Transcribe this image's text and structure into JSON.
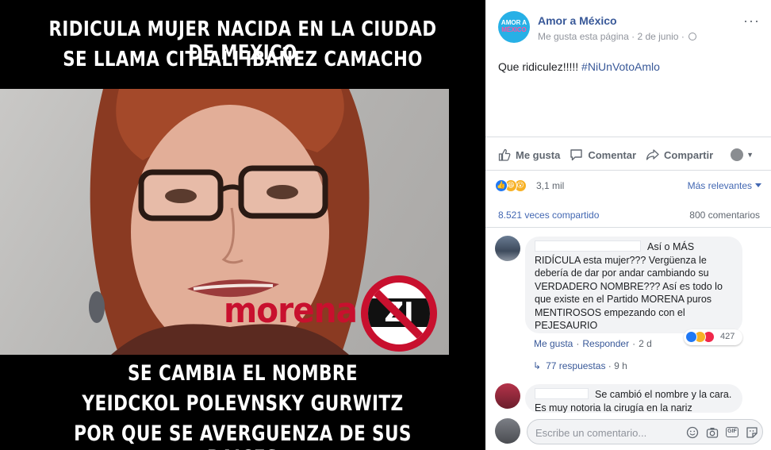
{
  "meme": {
    "caption_top": [
      "RIDICULA MUJER NACIDA EN LA CIUDAD DE MEXICO",
      "SE LLAMA CITLALI IBAÑEZ CAMACHO"
    ],
    "caption_bottom": [
      "SE CAMBIA EL NOMBRE",
      "YEIDCKOL POLEVNSKY GURWITZ",
      "POR QUE SE AVERGUENZA DE SUS RAICES"
    ],
    "logo_text": "morena",
    "logo_badge": "ZI"
  },
  "post": {
    "page_name": "Amor a México",
    "avatar_text": [
      "AMOR A",
      "MÉXICO"
    ],
    "like_page": "Me gusta esta página",
    "date": "2 de junio",
    "dot": "·",
    "text": "Que ridiculez!!!!! ",
    "hashtag": "#NiUnVotoAmlo",
    "menu": "···"
  },
  "actions": {
    "like": "Me gusta",
    "comment": "Comentar",
    "share": "Compartir"
  },
  "reactions": {
    "count": "3,1 mil",
    "sort": "Más relevantes",
    "shares": "8.521 veces compartido",
    "comments": "800 comentarios"
  },
  "comments": [
    {
      "text": "Así o MÁS RIDÍCULA esta mujer??? Vergüenza le debería de dar por andar cambiando su VERDADERO NOMBRE??? Así es todo lo que existe en el Partido MORENA puros MENTIROSOS empezando con el PEJESAURIO",
      "reaction_count": "427",
      "like": "Me gusta",
      "reply": "Responder",
      "time": "2 d",
      "replies": "77 respuestas",
      "replies_time": "9 h"
    },
    {
      "text": "Se cambió el nombre y la cara. Es muy notoria la cirugía en la nariz"
    }
  ],
  "composer": {
    "placeholder": "Escribe un comentario..."
  },
  "colors": {
    "link_blue": "#385898",
    "brand_blue": "#4267b2",
    "like_blue": "#2078f4",
    "morena_red": "#c8102e"
  },
  "icons": [
    "like-icon",
    "comment-icon",
    "share-icon",
    "emoji-icon",
    "camera-icon",
    "gif-icon",
    "sticker-icon",
    "globe-icon",
    "menu-icon"
  ]
}
